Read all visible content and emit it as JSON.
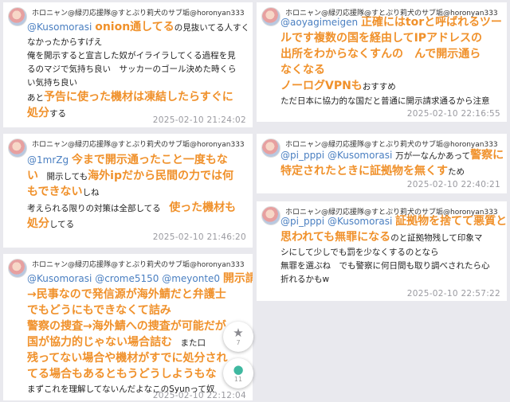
{
  "user_label": "ホロニャン@緑刃応援隊@すとぷり莉犬のサブ垢@horonyan333",
  "posts": [
    {
      "lines": [
        [
          {
            "t": "@Kusomorasi ",
            "c": "mention"
          },
          {
            "t": "onion通してる",
            "c": "hbig"
          },
          {
            "t": "の見抜いてる人すく",
            "c": "n"
          }
        ],
        [
          {
            "t": "なかったからすげえ",
            "c": "n"
          }
        ],
        [
          {
            "t": "俺を開示すると宣言した奴がイライラしてくる過程を見",
            "c": "n"
          }
        ],
        [
          {
            "t": "るのマジで気持ち良い　サッカーのゴール決めた時くら",
            "c": "n"
          }
        ],
        [
          {
            "t": "い気持ち良い",
            "c": "n"
          }
        ],
        [
          {
            "t": "あと",
            "c": "n"
          },
          {
            "t": "予告に使った機材は凍結したらすぐに",
            "c": "hbig"
          }
        ],
        [
          {
            "t": "処分",
            "c": "hbig"
          },
          {
            "t": "する",
            "c": "n"
          }
        ]
      ],
      "timestamp": "2025-02-10 21:24:02"
    },
    {
      "lines": [
        [
          {
            "t": "@1mrZg ",
            "c": "mention"
          },
          {
            "t": "今まで開示通ったこと一度もな",
            "c": "hbig"
          }
        ],
        [
          {
            "t": "い",
            "c": "hbig"
          },
          {
            "t": "　開示しても",
            "c": "n"
          },
          {
            "t": "海外ipだから民間の力では何",
            "c": "hbig"
          }
        ],
        [
          {
            "t": "もできない",
            "c": "hbig"
          },
          {
            "t": "しね",
            "c": "n"
          }
        ],
        [
          {
            "t": "考えられる限りの対策は全部してる　",
            "c": "n"
          },
          {
            "t": "使った機材も",
            "c": "hbig"
          }
        ],
        [
          {
            "t": "処分",
            "c": "hbig"
          },
          {
            "t": "してる",
            "c": "n"
          }
        ]
      ],
      "timestamp": "2025-02-10 21:46:20"
    },
    {
      "lines": [
        [
          {
            "t": "@Kusomorasi @crome5150 @meyonte0 ",
            "c": "mention"
          },
          {
            "t": "開示請求",
            "c": "hbig"
          }
        ],
        [
          {
            "t": "→民事なので発信源が海外鯖だと弁護士",
            "c": "hbig"
          }
        ],
        [
          {
            "t": "でもどうにもできなくて詰み",
            "c": "hbig"
          }
        ],
        [
          {
            "t": "警察の捜査→海外鯖への捜査が可能だが",
            "c": "hbig"
          }
        ],
        [
          {
            "t": "国が協力的じゃない場合詰む",
            "c": "hbig"
          },
          {
            "t": "　また口",
            "c": "n"
          }
        ],
        [
          {
            "t": "残ってない場合や機材がすでに処分され",
            "c": "hbig"
          }
        ],
        [
          {
            "t": "てる場合もあるともうどうしようもな",
            "c": "hbig"
          }
        ],
        [
          {
            "t": "まずこれを理解してないんだよなこのSyunって奴",
            "c": "n"
          }
        ]
      ],
      "timestamp": "2025-02-10 22:12:04"
    },
    {
      "lines": [
        [
          {
            "t": "@aoyagimeigen ",
            "c": "mention"
          },
          {
            "t": "正確にはtorと呼ばれるツー",
            "c": "hbig"
          }
        ],
        [
          {
            "t": "ルです複数の国を経由してIPアドレスの",
            "c": "hbig"
          }
        ],
        [
          {
            "t": "出所をわからなくすんの　んで開示通ら",
            "c": "hbig"
          }
        ],
        [
          {
            "t": "なくなる",
            "c": "hbig"
          }
        ],
        [
          {
            "t": "ノーログVPNも",
            "c": "hbig"
          },
          {
            "t": "おすすめ",
            "c": "n"
          }
        ],
        [
          {
            "t": "ただ日本に協力的な国だと普通に開示請求通るから注意",
            "c": "n"
          }
        ]
      ],
      "timestamp": "2025-02-10 22:16:55"
    },
    {
      "lines": [
        [
          {
            "t": "@pi_pppi @Kusomorasi ",
            "c": "mention"
          },
          {
            "t": "万が一なんかあって",
            "c": "n"
          },
          {
            "t": "警察に",
            "c": "hbig"
          }
        ],
        [
          {
            "t": "特定されたときに証拠物を無くす",
            "c": "hbig"
          },
          {
            "t": "ため",
            "c": "n"
          }
        ]
      ],
      "timestamp": "2025-02-10 22:40:21"
    },
    {
      "lines": [
        [
          {
            "t": "@pi_pppi @Kusomorasi ",
            "c": "mention"
          },
          {
            "t": "証拠物を捨てて悪質と",
            "c": "hbig"
          }
        ],
        [
          {
            "t": "思われても無罪になる",
            "c": "hbig"
          },
          {
            "t": "のと証拠物残して印象マ",
            "c": "n"
          }
        ],
        [
          {
            "t": "シにして少しでも罰を少なくするのとなら",
            "c": "n"
          }
        ],
        [
          {
            "t": "無罪を選ぶね　でも警察に何日間も取り調べされたら心",
            "c": "n"
          }
        ],
        [
          {
            "t": "折れるかもw",
            "c": "n"
          }
        ]
      ],
      "timestamp": "2025-02-10 22:57:22"
    }
  ],
  "fab": {
    "star_icon": "star-icon",
    "star_count": "7",
    "comment_icon": "comment-icon",
    "comment_count": "11"
  },
  "colors": {
    "highlight": "#f0912b",
    "mention": "#4a7fc1",
    "timestamp": "#9a9aa0"
  }
}
